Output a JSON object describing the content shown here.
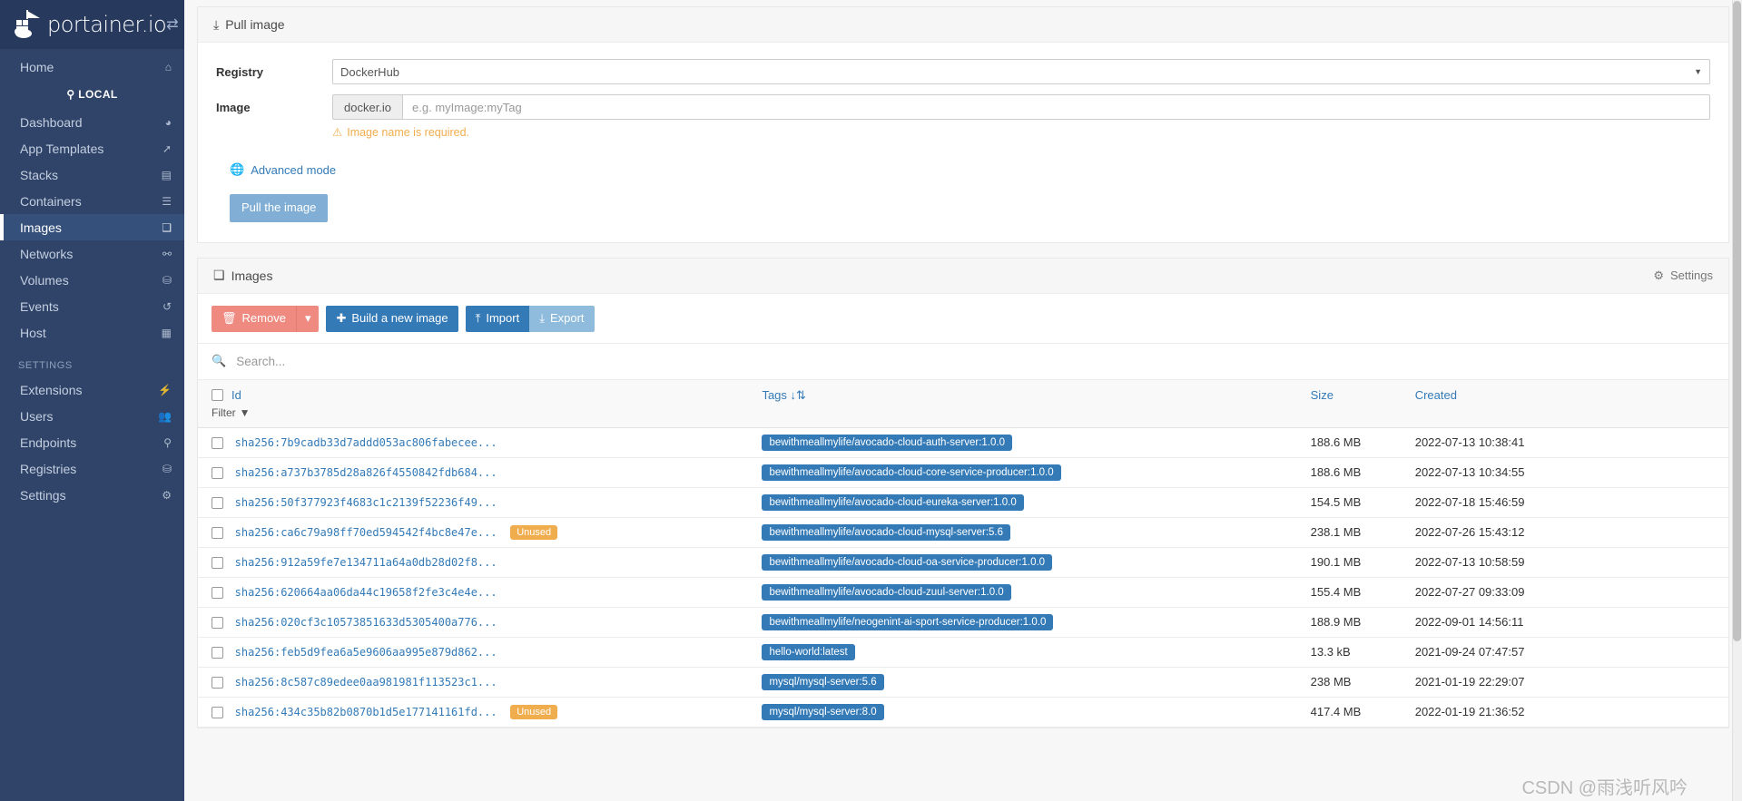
{
  "brand": {
    "name": "portainer.io",
    "logo_icon": "portainer-whale-icon",
    "toggle_icon": "sidebar-toggle-icon"
  },
  "sidebar": {
    "home": {
      "label": "Home",
      "icon": "home-icon"
    },
    "endpoint_label": "LOCAL",
    "endpoint_icon": "plug-icon",
    "items": [
      {
        "label": "Dashboard",
        "icon": "dashboard-icon",
        "active": false
      },
      {
        "label": "App Templates",
        "icon": "rocket-icon",
        "active": false
      },
      {
        "label": "Stacks",
        "icon": "stacks-icon",
        "active": false
      },
      {
        "label": "Containers",
        "icon": "containers-icon",
        "active": false
      },
      {
        "label": "Images",
        "icon": "images-icon",
        "active": true
      },
      {
        "label": "Networks",
        "icon": "networks-icon",
        "active": false
      },
      {
        "label": "Volumes",
        "icon": "volumes-icon",
        "active": false
      },
      {
        "label": "Events",
        "icon": "history-icon",
        "active": false
      },
      {
        "label": "Host",
        "icon": "host-icon",
        "active": false
      }
    ],
    "settings_section": "SETTINGS",
    "settings_items": [
      {
        "label": "Extensions",
        "icon": "bolt-icon"
      },
      {
        "label": "Users",
        "icon": "users-icon"
      },
      {
        "label": "Endpoints",
        "icon": "plug-icon"
      },
      {
        "label": "Registries",
        "icon": "database-icon"
      },
      {
        "label": "Settings",
        "icon": "gears-icon"
      }
    ]
  },
  "pull_panel": {
    "title": "Pull image",
    "title_icon": "download-icon",
    "registry_label": "Registry",
    "registry_value": "DockerHub",
    "registry_options": [
      "DockerHub"
    ],
    "image_label": "Image",
    "image_prefix": "docker.io",
    "image_placeholder": "e.g. myImage:myTag",
    "image_value": "",
    "warning_icon": "warning-triangle-icon",
    "warning_text": "Image name is required.",
    "advanced_icon": "globe-icon",
    "advanced_label": "Advanced mode",
    "pull_button": "Pull the image"
  },
  "images_panel": {
    "title": "Images",
    "title_icon": "images-icon",
    "settings_label": "Settings",
    "settings_icon": "gear-icon",
    "toolbar": {
      "remove_label": "Remove",
      "remove_icon": "trash-icon",
      "remove_caret_icon": "caret-down-icon",
      "build_label": "Build a new image",
      "build_icon": "plus-icon",
      "import_label": "Import",
      "import_icon": "upload-icon",
      "export_label": "Export",
      "export_icon": "download-icon"
    },
    "search": {
      "icon": "search-icon",
      "placeholder": "Search...",
      "value": ""
    },
    "columns": {
      "id": "Id",
      "id_filter_label": "Filter",
      "id_filter_icon": "funnel-icon",
      "tags": "Tags",
      "tags_sort_icon": "sort-alpha-asc-icon",
      "size": "Size",
      "created": "Created"
    },
    "rows": [
      {
        "id": "sha256:7b9cadb33d7addd053ac806fabecee...",
        "unused": false,
        "tag": "bewithmeallmylife/avocado-cloud-auth-server:1.0.0",
        "size": "188.6 MB",
        "created": "2022-07-13 10:38:41"
      },
      {
        "id": "sha256:a737b3785d28a826f4550842fdb684...",
        "unused": false,
        "tag": "bewithmeallmylife/avocado-cloud-core-service-producer:1.0.0",
        "size": "188.6 MB",
        "created": "2022-07-13 10:34:55"
      },
      {
        "id": "sha256:50f377923f4683c1c2139f52236f49...",
        "unused": false,
        "tag": "bewithmeallmylife/avocado-cloud-eureka-server:1.0.0",
        "size": "154.5 MB",
        "created": "2022-07-18 15:46:59"
      },
      {
        "id": "sha256:ca6c79a98ff70ed594542f4bc8e47e...",
        "unused": true,
        "tag": "bewithmeallmylife/avocado-cloud-mysql-server:5.6",
        "size": "238.1 MB",
        "created": "2022-07-26 15:43:12"
      },
      {
        "id": "sha256:912a59fe7e134711a64a0db28d02f8...",
        "unused": false,
        "tag": "bewithmeallmylife/avocado-cloud-oa-service-producer:1.0.0",
        "size": "190.1 MB",
        "created": "2022-07-13 10:58:59"
      },
      {
        "id": "sha256:620664aa06da44c19658f2fe3c4e4e...",
        "unused": false,
        "tag": "bewithmeallmylife/avocado-cloud-zuul-server:1.0.0",
        "size": "155.4 MB",
        "created": "2022-07-27 09:33:09"
      },
      {
        "id": "sha256:020cf3c10573851633d5305400a776...",
        "unused": false,
        "tag": "bewithmeallmylife/neogenint-ai-sport-service-producer:1.0.0",
        "size": "188.9 MB",
        "created": "2022-09-01 14:56:11"
      },
      {
        "id": "sha256:feb5d9fea6a5e9606aa995e879d862...",
        "unused": false,
        "tag": "hello-world:latest",
        "size": "13.3 kB",
        "created": "2021-09-24 07:47:57"
      },
      {
        "id": "sha256:8c587c89edee0aa981981f113523c1...",
        "unused": false,
        "tag": "mysql/mysql-server:5.6",
        "size": "238 MB",
        "created": "2021-01-19 22:29:07"
      },
      {
        "id": "sha256:434c35b82b0870b1d5e177141161fd...",
        "unused": true,
        "tag": "mysql/mysql-server:8.0",
        "size": "417.4 MB",
        "created": "2022-01-19 21:36:52"
      }
    ],
    "unused_badge": "Unused"
  },
  "watermark": "CSDN @雨浅听风吟",
  "colors": {
    "sidebar_bg": "#2f4468",
    "sidebar_active": "#36507c",
    "primary": "#337ab7",
    "danger": "#ef8a80",
    "warning": "#f0ad4e",
    "tag_badge": "#337ab7"
  }
}
